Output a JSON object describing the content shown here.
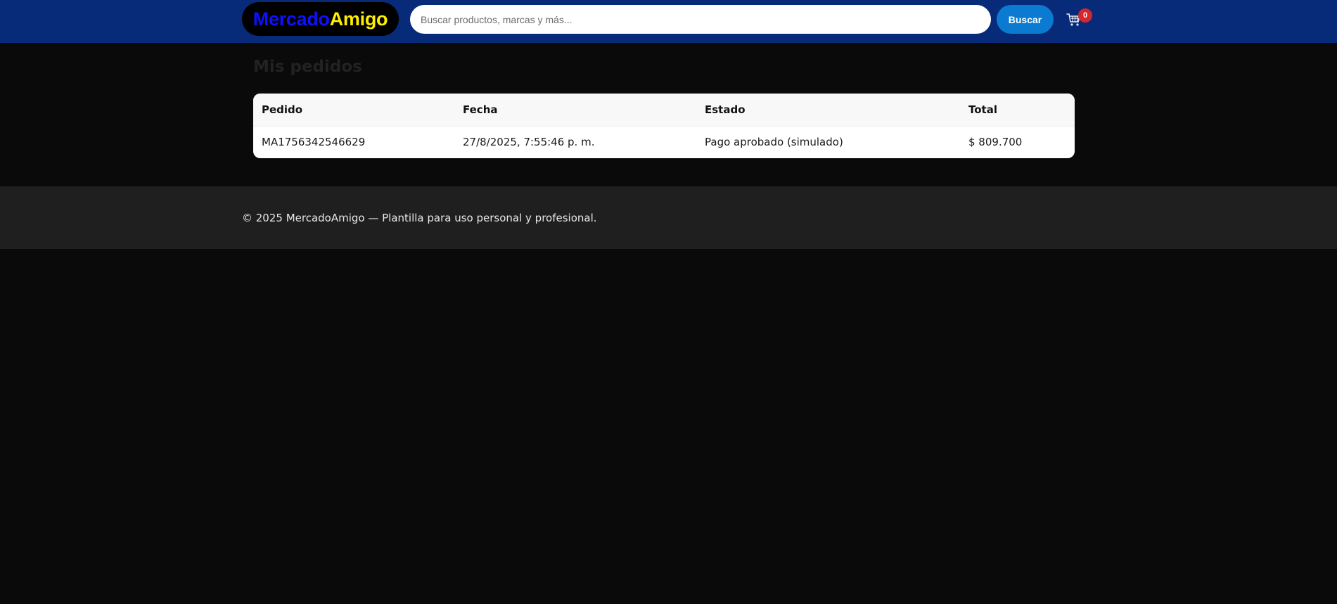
{
  "header": {
    "logo": {
      "part_a": "Mercado",
      "part_b": "Amigo",
      "part_a_color": "#0f10ff",
      "part_b_color": "#ffee00"
    },
    "search": {
      "placeholder": "Buscar productos, marcas y más...",
      "value": "",
      "button_label": "Buscar"
    },
    "cart": {
      "icon": "cart-icon",
      "count": "0"
    },
    "colors": {
      "bar": "#082b79",
      "button": "#0a7bd1",
      "badge": "#d6262b"
    }
  },
  "main": {
    "title": "Mis pedidos",
    "table": {
      "columns": [
        "Pedido",
        "Fecha",
        "Estado",
        "Total"
      ],
      "rows": [
        [
          "MA1756342546629",
          "27/8/2025, 7:55:46 p. m.",
          "Pago aprobado (simulado)",
          "$ 809.700"
        ]
      ]
    }
  },
  "footer": {
    "text": "© 2025 MercadoAmigo — Plantilla para uso personal y profesional."
  }
}
